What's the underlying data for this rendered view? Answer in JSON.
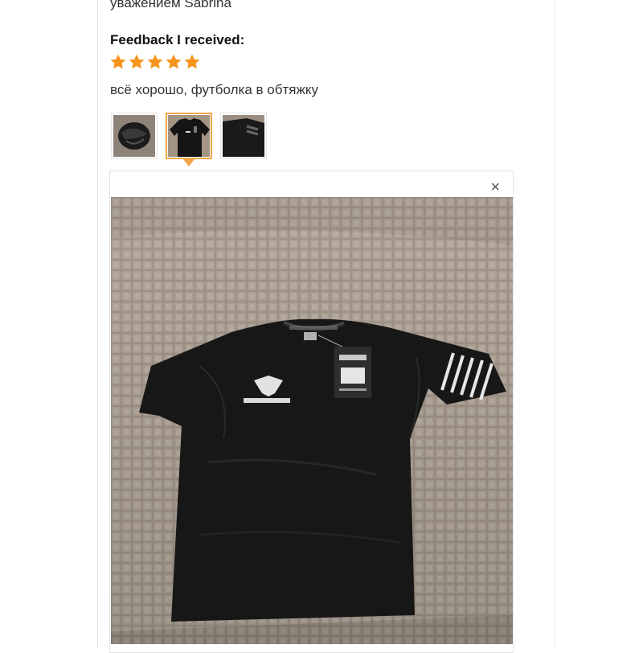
{
  "review": {
    "signature": "уважением Sabrina",
    "feedback_heading": "Feedback I received:",
    "rating": 5,
    "rating_max": 5,
    "comment": "всё хорошо, футболка в обтяжку"
  },
  "thumbnails": [
    {
      "name": "photo-1",
      "selected": false
    },
    {
      "name": "photo-2",
      "selected": true
    },
    {
      "name": "photo-3",
      "selected": false
    }
  ],
  "viewer": {
    "close_glyph": "×",
    "icon": "close-icon"
  },
  "colors": {
    "star": "#f7941d",
    "selected_border": "#f0a54b",
    "sofa": "#a6988b",
    "shirt": "#161616"
  }
}
